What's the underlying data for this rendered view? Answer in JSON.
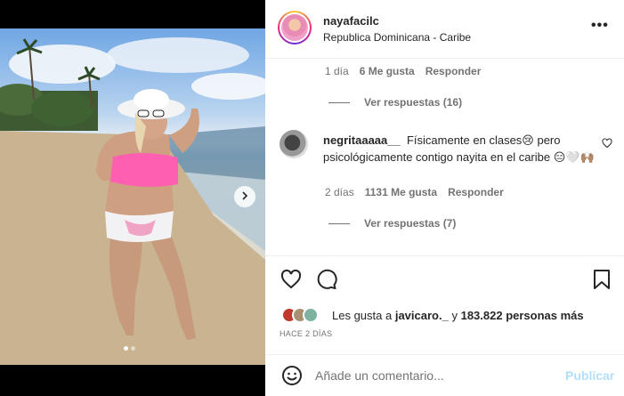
{
  "post": {
    "username": "nayafacilc",
    "location": "Republica Dominicana - Caribe",
    "more_icon": "more-horizontal-icon"
  },
  "comment_prev": {
    "time": "1 día",
    "likes": "6 Me gusta",
    "reply_label": "Responder",
    "view_replies": "Ver respuestas (16)"
  },
  "comment": {
    "username": "negritaaaaa__",
    "text": "Físicamente en clases😢 pero psicológicamente contigo nayita en el caribe 😑🤍🙌🏽",
    "time": "2 días",
    "likes": "1131 Me gusta",
    "reply_label": "Responder",
    "view_replies": "Ver respuestas (7)"
  },
  "actions": {
    "like_icon": "heart-icon",
    "comment_icon": "comment-bubble-icon",
    "save_icon": "bookmark-icon",
    "likes_prefix": "Les gusta a",
    "liked_by": "javicaro._",
    "likes_middle": "y",
    "likes_count": "183.822 personas más",
    "time_ago": "HACE 2 DÍAS"
  },
  "add_comment": {
    "placeholder": "Añade un comentario...",
    "post_label": "Publicar",
    "emoji_icon": "emoji-smile-icon"
  },
  "carousel": {
    "current": 1,
    "total": 2
  },
  "colors": {
    "link_disabled": "#b2dffc",
    "secondary_text": "#737373",
    "primary_text": "#262626"
  }
}
